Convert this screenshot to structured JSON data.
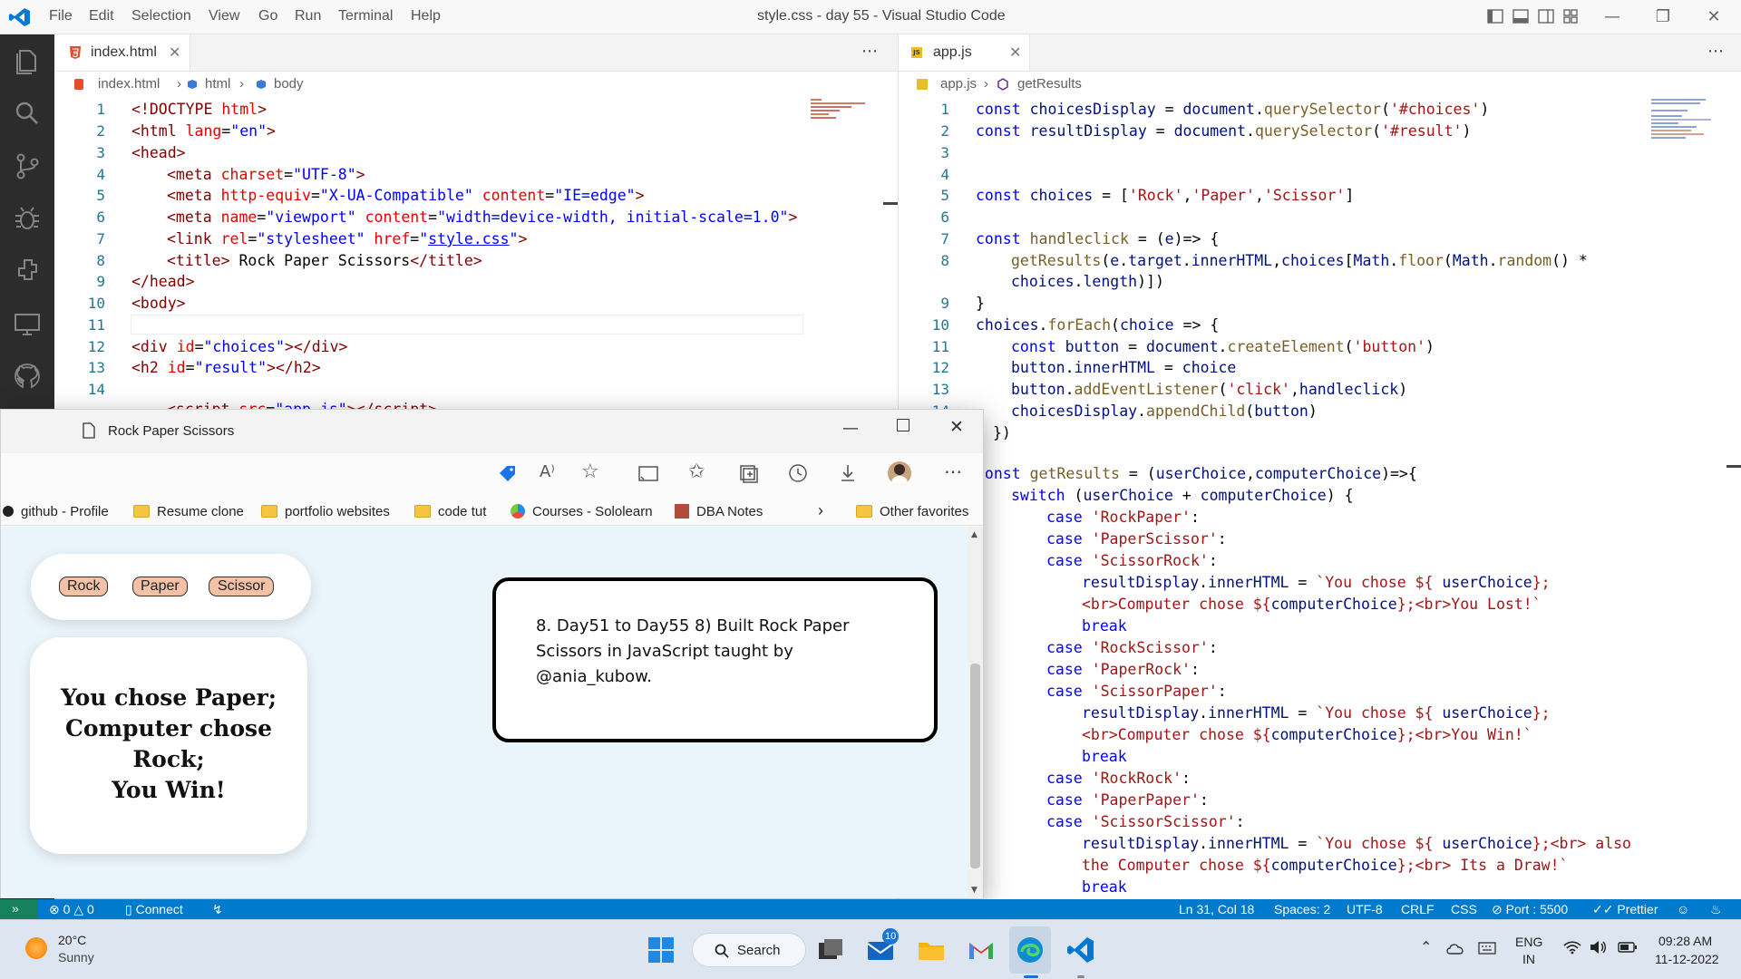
{
  "titlebar": {
    "menu": [
      "File",
      "Edit",
      "Selection",
      "View",
      "Go",
      "Run",
      "Terminal",
      "Help"
    ],
    "title": "style.css - day 55 - Visual Studio Code"
  },
  "left_editor": {
    "tab_label": "index.html",
    "breadcrumb": [
      "index.html",
      "html",
      "body"
    ],
    "line_numbers": [
      "1",
      "2",
      "3",
      "4",
      "5",
      "6",
      "7",
      "8",
      "9",
      "10",
      "11",
      "12",
      "13",
      "14"
    ]
  },
  "right_editor": {
    "tab_label": "app.js",
    "breadcrumb": [
      "app.js",
      "getResults"
    ],
    "line_numbers": [
      "1",
      "2",
      "3",
      "4",
      "5",
      "6",
      "7",
      "8",
      "",
      "9",
      "10",
      "11",
      "12",
      "13",
      "14",
      "",
      "",
      "",
      "",
      "",
      "",
      "",
      "",
      "",
      "",
      "",
      "",
      "",
      "",
      "",
      "",
      ""
    ]
  },
  "browser": {
    "tab_title": "Rock Paper Scissors",
    "favorites": [
      "github - Profile",
      "Resume clone",
      "portfolio websites",
      "code tut",
      "Courses - Sololearn",
      "DBA Notes",
      "Other favorites"
    ],
    "choice_buttons": [
      "Rock",
      "Paper",
      "Scissor"
    ],
    "result_lines": [
      "You chose Paper;",
      "Computer chose",
      "Rock;",
      "You Win!"
    ],
    "note_text": "8. Day51 to Day55  8) Built Rock Paper Scissors in JavaScript taught by @ania_kubow."
  },
  "statusbar": {
    "errors": "0",
    "warnings": "0",
    "connect": "Connect",
    "position": "Ln 31, Col 18",
    "spaces": "Spaces: 2",
    "encoding": "UTF-8",
    "eol": "CRLF",
    "language": "CSS",
    "port": "Port : 5500",
    "prettier": "Prettier"
  },
  "taskbar": {
    "temperature": "20°C",
    "weather": "Sunny",
    "search_label": "Search",
    "mail_badge": "10",
    "lang_line1": "ENG",
    "lang_line2": "IN",
    "time": "09:28 AM",
    "date": "11-12-2022"
  },
  "colors": {
    "activity_bar": "#2c2c2c",
    "status_bar": "#007acc",
    "taskbar": "#dde6f0",
    "page_background": "#eaf4fb",
    "button_fill": "#f2c1a6"
  }
}
